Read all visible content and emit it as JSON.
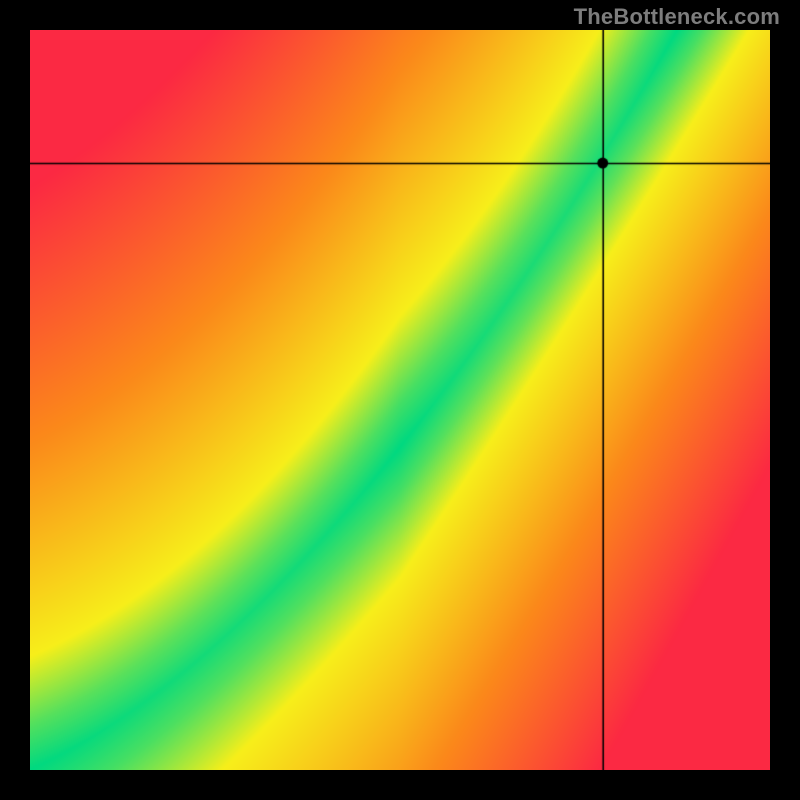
{
  "watermark": "TheBottleneck.com",
  "colors": {
    "background": "#000000",
    "watermark": "#7d7d7d"
  },
  "chart_data": {
    "type": "heatmap",
    "title": "",
    "xlabel": "",
    "ylabel": "",
    "xlim": [
      0,
      1
    ],
    "ylim": [
      0,
      1
    ],
    "description": "Heatmap of bottleneck mismatch. For each (x,y) in the unit square the ideal-curve y*(x) is defined; color encodes |y - y*(x)| from green (0 mismatch) through yellow to red (max mismatch). A black crosshair marks a query point.",
    "ideal_curve_samples": {
      "x": [
        0.0,
        0.1,
        0.2,
        0.3,
        0.4,
        0.5,
        0.6,
        0.7,
        0.8,
        0.9,
        1.0
      ],
      "y": [
        0.0,
        0.06,
        0.13,
        0.21,
        0.32,
        0.45,
        0.61,
        0.78,
        0.95,
        1.1,
        1.25
      ]
    },
    "band_halfwidth": 0.06,
    "crosshair": {
      "x": 0.775,
      "y": 0.82
    },
    "color_stops": [
      {
        "t": 0.0,
        "hex": "#00d981"
      },
      {
        "t": 0.18,
        "hex": "#f7ef1a"
      },
      {
        "t": 0.55,
        "hex": "#fb8a1a"
      },
      {
        "t": 1.0,
        "hex": "#fb2943"
      }
    ]
  }
}
